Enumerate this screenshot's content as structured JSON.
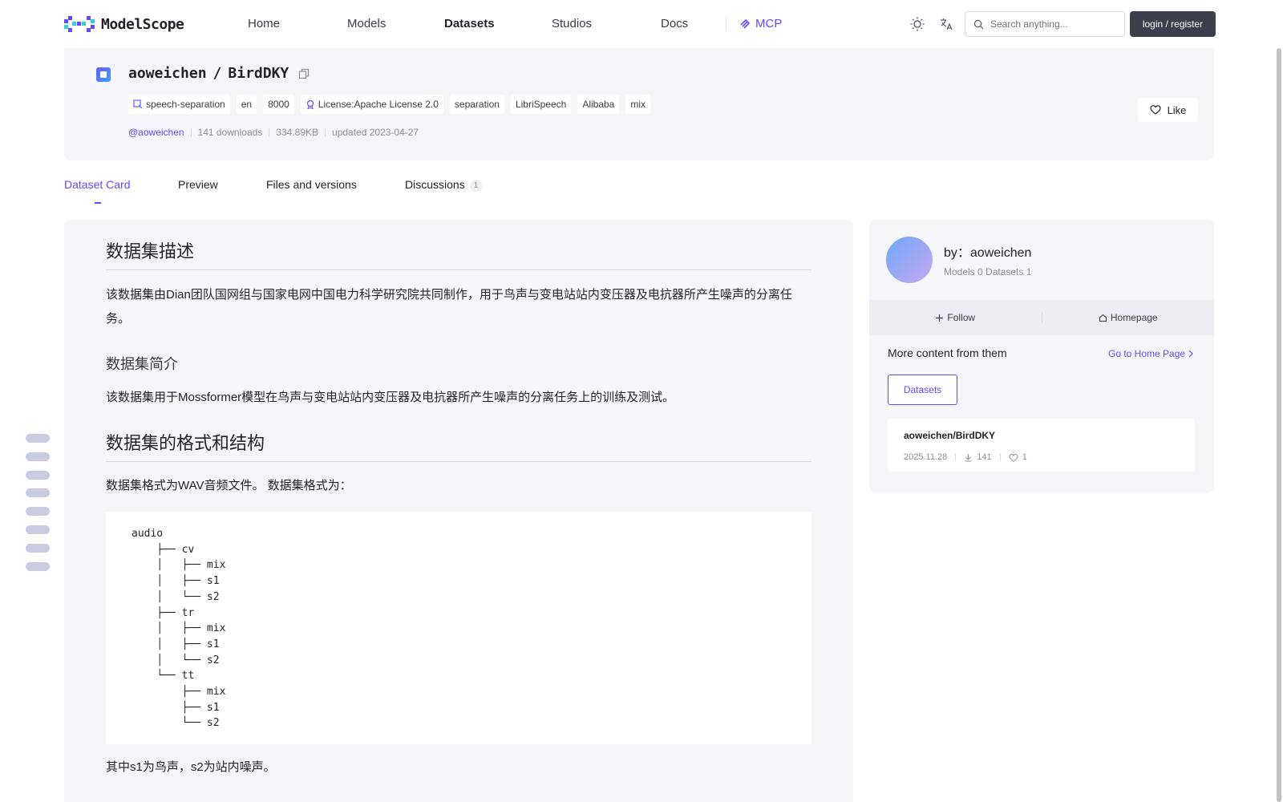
{
  "header": {
    "logo_text": "ModelScope",
    "nav": [
      {
        "label": "Home",
        "active": false
      },
      {
        "label": "Models",
        "active": false
      },
      {
        "label": "Datasets",
        "active": true
      },
      {
        "label": "Studios",
        "active": false
      },
      {
        "label": "Docs",
        "active": false
      }
    ],
    "mcp_label": "MCP",
    "search_placeholder": "Search anything...",
    "login_label": "login / register",
    "accent_color": "#624aff"
  },
  "dataset": {
    "owner": "aoweichen",
    "separator": "/",
    "name": "BirdDKY",
    "tags": [
      "speech-separation",
      "en",
      "8000",
      "License:Apache License 2.0",
      "separation",
      "LibriSpeech",
      "Alibaba",
      "mix"
    ],
    "meta": {
      "author": "@aoweichen",
      "downloads": "141 downloads",
      "size": "334.89KB",
      "updated": "updated 2023-04-27"
    },
    "like_label": "Like"
  },
  "tabs": [
    {
      "label": "Dataset Card",
      "active": true
    },
    {
      "label": "Preview",
      "active": false
    },
    {
      "label": "Files and versions",
      "active": false
    },
    {
      "label": "Discussions",
      "badge": "1",
      "active": false
    }
  ],
  "content": {
    "h_description": "数据集描述",
    "p_description": "该数据集由Dian团队国网组与国家电网中国电力科学研究院共同制作，用于鸟声与变电站站内变压器及电抗器所产生噪声的分离任务。",
    "h_intro": "数据集简介",
    "p_intro": "该数据集用于Mossformer模型在鸟声与变电站站内变压器及电抗器所产生噪声的分离任务上的训练及测试。",
    "h_format": "数据集的格式和结构",
    "p_format": "数据集格式为WAV音频文件。 数据集格式为：",
    "code_tree": "audio\n    ├── cv\n    │   ├── mix\n    │   ├── s1\n    │   └── s2\n    ├── tr\n    │   ├── mix\n    │   ├── s1\n    │   └── s2\n    └── tt\n        ├── mix\n        ├── s1\n        └── s2",
    "p_note": "其中s1为鸟声，s2为站内噪声。"
  },
  "sidebar": {
    "by_label": "by：aoweichen",
    "counts": "Models 0  Datasets 1",
    "follow_label": "Follow",
    "homepage_label": "Homepage",
    "more_label": "More content from them",
    "goto_label": "Go to Home Page",
    "datasets_tab": "Datasets",
    "card": {
      "title": "aoweichen/BirdDKY",
      "date": "2025.11.28",
      "downloads": "141",
      "likes": "1"
    }
  }
}
